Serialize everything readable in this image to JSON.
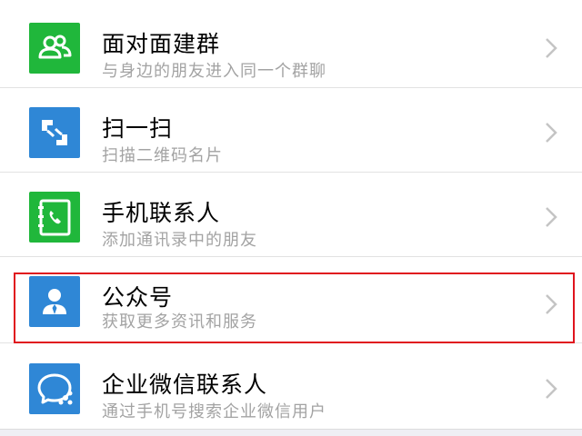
{
  "menu": {
    "items": [
      {
        "title": "面对面建群",
        "subtitle": "与身边的朋友进入同一个群聊",
        "icon": "two-people-icon",
        "icon_color": "#20b73b"
      },
      {
        "title": "扫一扫",
        "subtitle": "扫描二维码名片",
        "icon": "scan-icon",
        "icon_color": "#2f87d6"
      },
      {
        "title": "手机联系人",
        "subtitle": "添加通讯录中的朋友",
        "icon": "phone-contact-icon",
        "icon_color": "#20b73b"
      },
      {
        "title": "公众号",
        "subtitle": "获取更多资讯和服务",
        "icon": "official-account-icon",
        "icon_color": "#2f87d6",
        "highlighted": true
      },
      {
        "title": "企业微信联系人",
        "subtitle": "通过手机号搜索企业微信用户",
        "icon": "work-wechat-icon",
        "icon_color": "#2f87d6"
      }
    ],
    "chevron_icon": "chevron-right-icon"
  },
  "colors": {
    "highlight_border": "#e0141e",
    "green": "#20b73b",
    "blue": "#2f87d6",
    "subtitle_text": "#a3a3a3"
  }
}
